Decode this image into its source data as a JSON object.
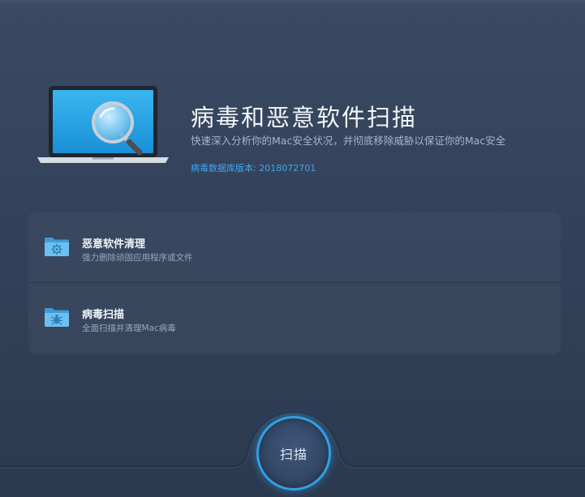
{
  "hero": {
    "title": "病毒和恶意软件扫描",
    "subtitle": "快速深入分析你的Mac安全状况，并彻底移除威胁以保证你的Mac安全",
    "db_version": "病毒数据库版本: 2018072701",
    "illustration_icon": "laptop-magnifier-icon"
  },
  "modules": [
    {
      "name": "恶意软件清理",
      "desc": "强力删除顽固应用程序或文件",
      "icon": "folder-gear-icon"
    },
    {
      "name": "病毒扫描",
      "desc": "全面扫描并清理Mac病毒",
      "icon": "folder-bug-icon"
    }
  ],
  "scan_button": {
    "label": "扫描"
  },
  "colors": {
    "accent": "#2fa0e6",
    "db_version_text": "#3ea5f2",
    "background_top": "#3a4a63",
    "background_bottom": "#2c3a50"
  }
}
